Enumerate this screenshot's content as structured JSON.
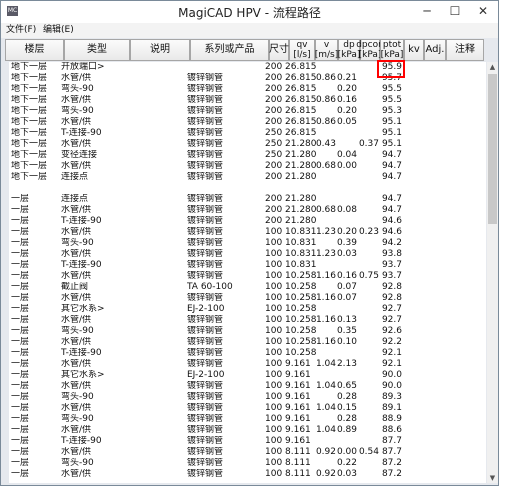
{
  "window": {
    "title": "MagiCAD HPV - 流程路径",
    "icon_label": "MC",
    "controls": {
      "minimize": "─",
      "maximize": "☐",
      "close": "✕"
    }
  },
  "menu": [
    "文件(F)",
    "编辑(E)"
  ],
  "columns": [
    {
      "label": "楼层"
    },
    {
      "label": "类型"
    },
    {
      "label": "说明"
    },
    {
      "label": "系列或产品"
    },
    {
      "label": "尺寸"
    },
    {
      "label": "qv\n[l/s]"
    },
    {
      "label": "v\n[m/s]"
    },
    {
      "label": "dp\n[kPa]"
    },
    {
      "label": "dpcon\n[kPa]"
    },
    {
      "label": "ptot\n[kPa]"
    },
    {
      "label": "kv"
    },
    {
      "label": "Adj."
    },
    {
      "label": "注释"
    }
  ],
  "rows": [
    {
      "floor": "地下一层",
      "type": "开放端口>",
      "desc": "",
      "series": "",
      "size": "200",
      "qv": "26.815",
      "v": "",
      "dp": "",
      "dpcon": "",
      "ptot": "95.9"
    },
    {
      "floor": "地下一层",
      "type": "水管/供",
      "desc": "",
      "series": "镀锌钢管",
      "size": "200",
      "qv": "26.815",
      "v": "0.86",
      "dp": "0.21",
      "dpcon": "",
      "ptot": "95.7"
    },
    {
      "floor": "地下一层",
      "type": "弯头-90",
      "desc": "",
      "series": "镀锌钢管",
      "size": "200",
      "qv": "26.815",
      "v": "",
      "dp": "0.20",
      "dpcon": "",
      "ptot": "95.5"
    },
    {
      "floor": "地下一层",
      "type": "水管/供",
      "desc": "",
      "series": "镀锌钢管",
      "size": "200",
      "qv": "26.815",
      "v": "0.86",
      "dp": "0.16",
      "dpcon": "",
      "ptot": "95.5"
    },
    {
      "floor": "地下一层",
      "type": "弯头-90",
      "desc": "",
      "series": "镀锌钢管",
      "size": "200",
      "qv": "26.815",
      "v": "",
      "dp": "0.20",
      "dpcon": "",
      "ptot": "95.3"
    },
    {
      "floor": "地下一层",
      "type": "水管/供",
      "desc": "",
      "series": "镀锌钢管",
      "size": "200",
      "qv": "26.815",
      "v": "0.86",
      "dp": "0.05",
      "dpcon": "",
      "ptot": "95.1"
    },
    {
      "floor": "地下一层",
      "type": "T-连接-90",
      "desc": "",
      "series": "镀锌钢管",
      "size": "250",
      "qv": "26.815",
      "v": "",
      "dp": "",
      "dpcon": "",
      "ptot": "95.1"
    },
    {
      "floor": "地下一层",
      "type": "水管/供",
      "desc": "",
      "series": "镀锌钢管",
      "size": "250",
      "qv": "21.280",
      "v": "0.43",
      "dp": "",
      "dpcon": "0.37",
      "ptot": "95.1"
    },
    {
      "floor": "地下一层",
      "type": "变径连接",
      "desc": "",
      "series": "镀锌钢管",
      "size": "250",
      "qv": "21.280",
      "v": "",
      "dp": "0.04",
      "dpcon": "",
      "ptot": "94.7"
    },
    {
      "floor": "地下一层",
      "type": "水管/供",
      "desc": "",
      "series": "镀锌钢管",
      "size": "200",
      "qv": "21.280",
      "v": "0.68",
      "dp": "0.00",
      "dpcon": "",
      "ptot": "94.7"
    },
    {
      "floor": "地下一层",
      "type": "连接点",
      "desc": "",
      "series": "镀锌钢管",
      "size": "200",
      "qv": "21.280",
      "v": "",
      "dp": "",
      "dpcon": "",
      "ptot": "94.7"
    },
    {
      "floor": "",
      "type": "",
      "desc": "",
      "series": "",
      "size": "",
      "qv": "",
      "v": "",
      "dp": "",
      "dpcon": "",
      "ptot": ""
    },
    {
      "floor": "一层",
      "type": "连接点",
      "desc": "",
      "series": "镀锌钢管",
      "size": "200",
      "qv": "21.280",
      "v": "",
      "dp": "",
      "dpcon": "",
      "ptot": "94.7"
    },
    {
      "floor": "一层",
      "type": "水管/供",
      "desc": "",
      "series": "镀锌钢管",
      "size": "200",
      "qv": "21.280",
      "v": "0.68",
      "dp": "0.08",
      "dpcon": "",
      "ptot": "94.7"
    },
    {
      "floor": "一层",
      "type": "T-连接-90",
      "desc": "",
      "series": "镀锌钢管",
      "size": "200",
      "qv": "21.280",
      "v": "",
      "dp": "",
      "dpcon": "",
      "ptot": "94.6"
    },
    {
      "floor": "一层",
      "type": "水管/供",
      "desc": "",
      "series": "镀锌钢管",
      "size": "100",
      "qv": "10.831",
      "v": "1.23",
      "dp": "0.20",
      "dpcon": "0.23",
      "ptot": "94.6"
    },
    {
      "floor": "一层",
      "type": "弯头-90",
      "desc": "",
      "series": "镀锌钢管",
      "size": "100",
      "qv": "10.831",
      "v": "",
      "dp": "0.39",
      "dpcon": "",
      "ptot": "94.2"
    },
    {
      "floor": "一层",
      "type": "水管/供",
      "desc": "",
      "series": "镀锌钢管",
      "size": "100",
      "qv": "10.831",
      "v": "1.23",
      "dp": "0.03",
      "dpcon": "",
      "ptot": "93.8"
    },
    {
      "floor": "一层",
      "type": "T-连接-90",
      "desc": "",
      "series": "镀锌钢管",
      "size": "100",
      "qv": "10.831",
      "v": "",
      "dp": "",
      "dpcon": "",
      "ptot": "93.7"
    },
    {
      "floor": "一层",
      "type": "水管/供",
      "desc": "",
      "series": "镀锌钢管",
      "size": "100",
      "qv": "10.258",
      "v": "1.16",
      "dp": "0.16",
      "dpcon": "0.75",
      "ptot": "93.7"
    },
    {
      "floor": "一层",
      "type": "截止阀",
      "desc": "",
      "series": "TA 60-100",
      "size": "100",
      "qv": "10.258",
      "v": "",
      "dp": "0.07",
      "dpcon": "",
      "ptot": "92.8"
    },
    {
      "floor": "一层",
      "type": "水管/供",
      "desc": "",
      "series": "镀锌钢管",
      "size": "100",
      "qv": "10.258",
      "v": "1.16",
      "dp": "0.07",
      "dpcon": "",
      "ptot": "92.8"
    },
    {
      "floor": "一层",
      "type": "其它水系>",
      "desc": "",
      "series": "EJ-2-100",
      "size": "100",
      "qv": "10.258",
      "v": "",
      "dp": "",
      "dpcon": "",
      "ptot": "92.7"
    },
    {
      "floor": "一层",
      "type": "水管/供",
      "desc": "",
      "series": "镀锌钢管",
      "size": "100",
      "qv": "10.258",
      "v": "1.16",
      "dp": "0.13",
      "dpcon": "",
      "ptot": "92.7"
    },
    {
      "floor": "一层",
      "type": "弯头-90",
      "desc": "",
      "series": "镀锌钢管",
      "size": "100",
      "qv": "10.258",
      "v": "",
      "dp": "0.35",
      "dpcon": "",
      "ptot": "92.6"
    },
    {
      "floor": "一层",
      "type": "水管/供",
      "desc": "",
      "series": "镀锌钢管",
      "size": "100",
      "qv": "10.258",
      "v": "1.16",
      "dp": "0.10",
      "dpcon": "",
      "ptot": "92.2"
    },
    {
      "floor": "一层",
      "type": "T-连接-90",
      "desc": "",
      "series": "镀锌钢管",
      "size": "100",
      "qv": "10.258",
      "v": "",
      "dp": "",
      "dpcon": "",
      "ptot": "92.1"
    },
    {
      "floor": "一层",
      "type": "水管/供",
      "desc": "",
      "series": "镀锌钢管",
      "size": "100",
      "qv": "9.161",
      "v": "1.04",
      "dp": "2.13",
      "dpcon": "",
      "ptot": "92.1"
    },
    {
      "floor": "一层",
      "type": "其它水系>",
      "desc": "",
      "series": "EJ-2-100",
      "size": "100",
      "qv": "9.161",
      "v": "",
      "dp": "",
      "dpcon": "",
      "ptot": "90.0"
    },
    {
      "floor": "一层",
      "type": "水管/供",
      "desc": "",
      "series": "镀锌钢管",
      "size": "100",
      "qv": "9.161",
      "v": "1.04",
      "dp": "0.65",
      "dpcon": "",
      "ptot": "90.0"
    },
    {
      "floor": "一层",
      "type": "弯头-90",
      "desc": "",
      "series": "镀锌钢管",
      "size": "100",
      "qv": "9.161",
      "v": "",
      "dp": "0.28",
      "dpcon": "",
      "ptot": "89.3"
    },
    {
      "floor": "一层",
      "type": "水管/供",
      "desc": "",
      "series": "镀锌钢管",
      "size": "100",
      "qv": "9.161",
      "v": "1.04",
      "dp": "0.15",
      "dpcon": "",
      "ptot": "89.1"
    },
    {
      "floor": "一层",
      "type": "弯头-90",
      "desc": "",
      "series": "镀锌钢管",
      "size": "100",
      "qv": "9.161",
      "v": "",
      "dp": "0.28",
      "dpcon": "",
      "ptot": "88.9"
    },
    {
      "floor": "一层",
      "type": "水管/供",
      "desc": "",
      "series": "镀锌钢管",
      "size": "100",
      "qv": "9.161",
      "v": "1.04",
      "dp": "0.89",
      "dpcon": "",
      "ptot": "88.6"
    },
    {
      "floor": "一层",
      "type": "T-连接-90",
      "desc": "",
      "series": "镀锌钢管",
      "size": "100",
      "qv": "9.161",
      "v": "",
      "dp": "",
      "dpcon": "",
      "ptot": "87.7"
    },
    {
      "floor": "一层",
      "type": "水管/供",
      "desc": "",
      "series": "镀锌钢管",
      "size": "100",
      "qv": "8.111",
      "v": "0.92",
      "dp": "0.00",
      "dpcon": "0.54",
      "ptot": "87.7"
    },
    {
      "floor": "一层",
      "type": "弯头-90",
      "desc": "",
      "series": "镀锌钢管",
      "size": "100",
      "qv": "8.111",
      "v": "",
      "dp": "0.22",
      "dpcon": "",
      "ptot": "87.2"
    },
    {
      "floor": "一层",
      "type": "水管/供",
      "desc": "",
      "series": "镀锌钢管",
      "size": "100",
      "qv": "8.111",
      "v": "0.92",
      "dp": "0.03",
      "dpcon": "",
      "ptot": "87.2"
    }
  ],
  "highlight_color": "#ff0000"
}
